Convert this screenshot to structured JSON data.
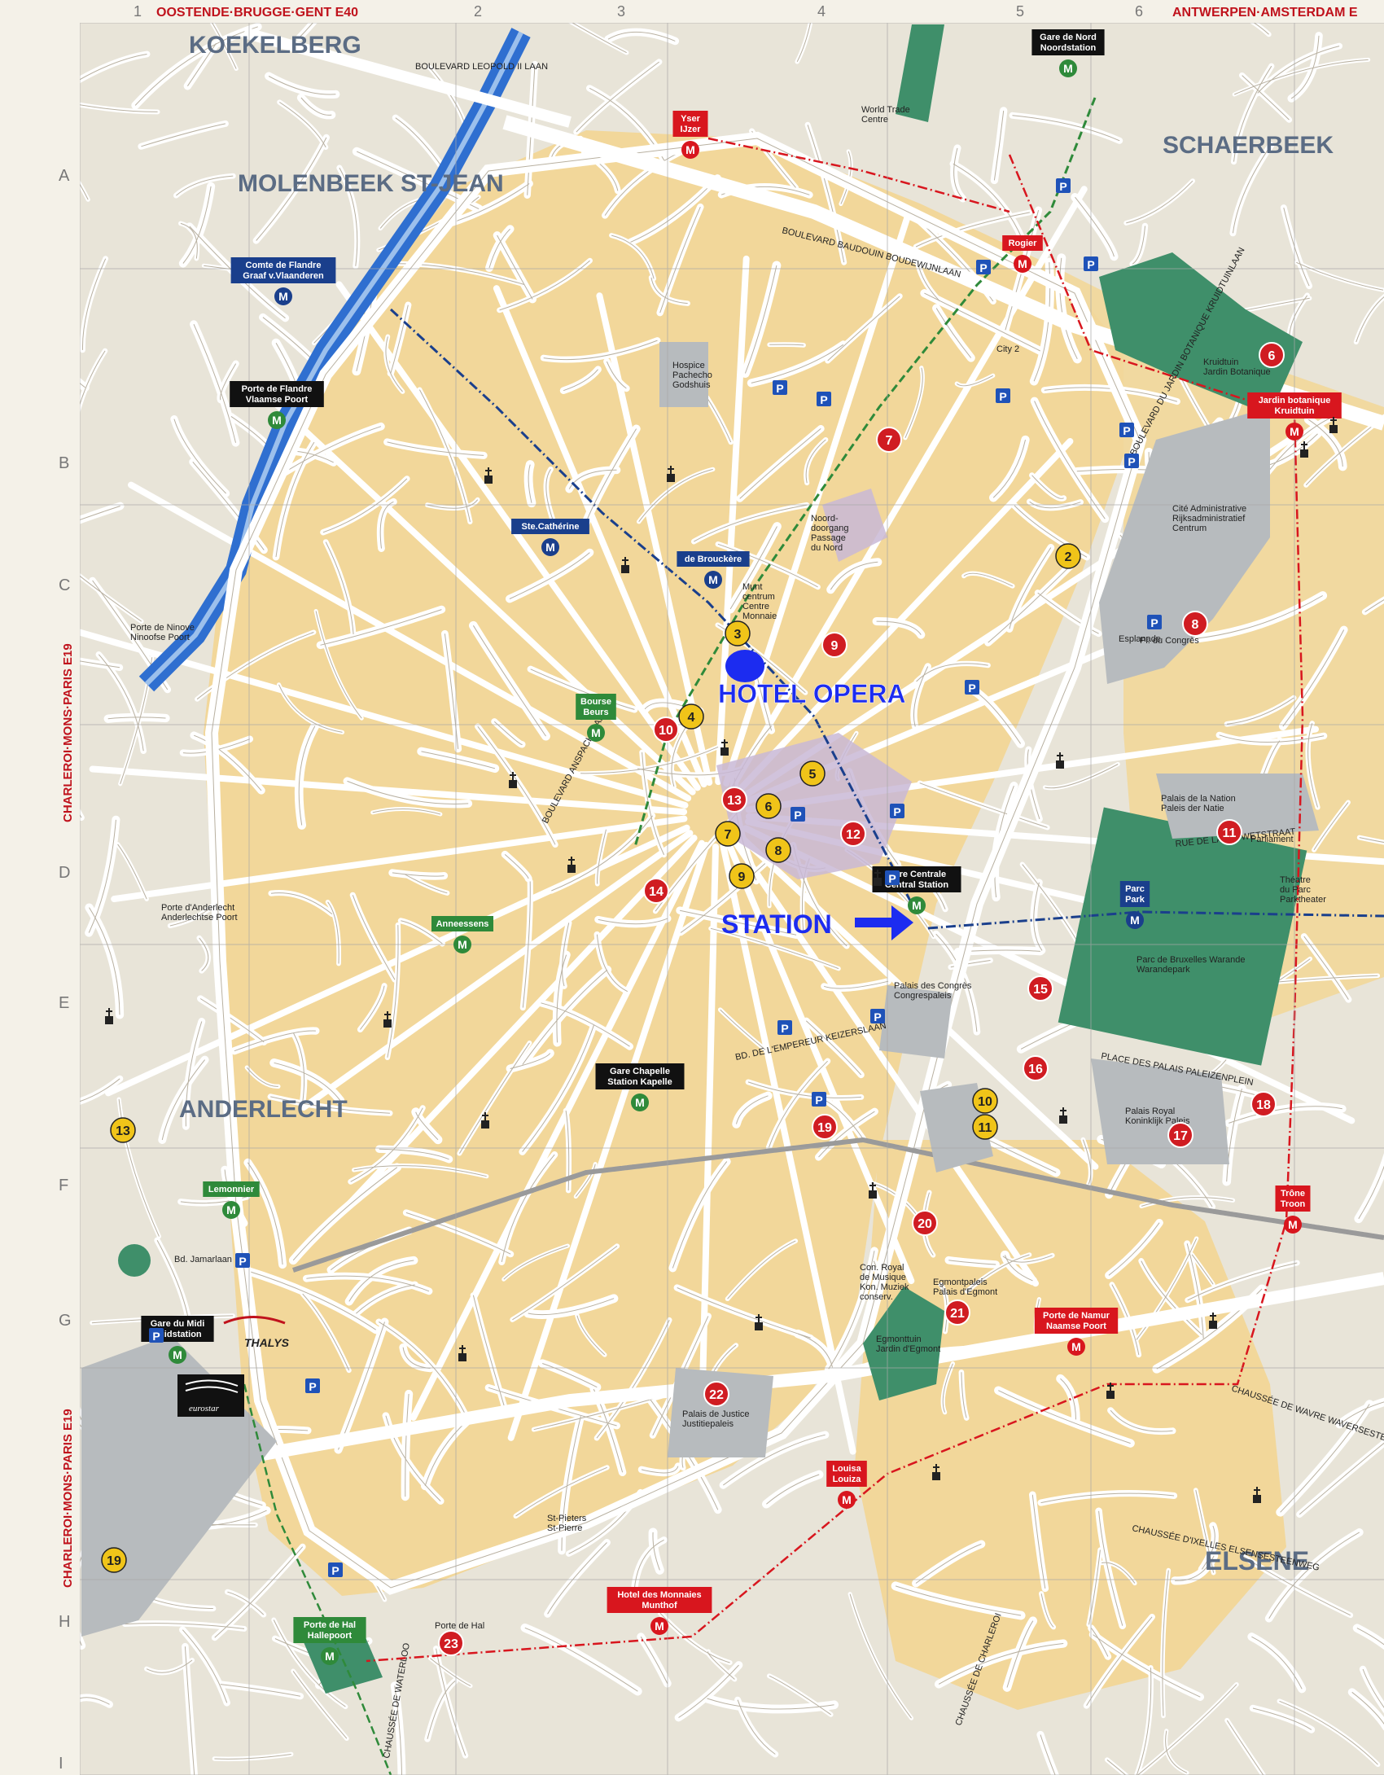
{
  "map": {
    "grid_columns": [
      "1",
      "2",
      "3",
      "4",
      "5",
      "6"
    ],
    "grid_rows": [
      "A",
      "B",
      "C",
      "D",
      "E",
      "F",
      "G",
      "H",
      "I"
    ],
    "edge_roads": {
      "top_left": "OOSTENDE·BRUGGE·GENT E40",
      "top_right": "ANTWERPEN·AMSTERDAM E",
      "left_upper": "CHARLEROI·MONS·PARIS E19",
      "left_lower": "CHARLEROI·MONS·PARIS E19"
    },
    "districts": {
      "koekelberg": "KOEKELBERG",
      "molenbeek": "MOLENBEEK ST-JEAN",
      "schaerbeek": "SCHAERBEEK",
      "anderlecht": "ANDERLECHT",
      "elsene": "ELSENE"
    },
    "annotations": {
      "hotel": "HOTEL OPERA",
      "station": "STATION"
    },
    "metro_stations": [
      {
        "label": "Gare de Nord\nNoordstation",
        "color": "#111111"
      },
      {
        "label": "Yser\nIJzer",
        "color": "#d8161e"
      },
      {
        "label": "Rogier",
        "color": "#d8161e"
      },
      {
        "label": "Comte de Flandre\nGraaf v.Vlaanderen",
        "color": "#1a3f8c"
      },
      {
        "label": "Porte de Flandre\nVlaamse Poort",
        "color": "#111111"
      },
      {
        "label": "Ste.Cathérine",
        "color": "#1a3f8c"
      },
      {
        "label": "de Brouckère",
        "color": "#1a3f8c"
      },
      {
        "label": "Bourse\nBeurs",
        "color": "#2f8a3a"
      },
      {
        "label": "Gare Centrale\nCentral Station",
        "color": "#111111"
      },
      {
        "label": "Parc\nPark",
        "color": "#1a3f8c"
      },
      {
        "label": "Anneessens",
        "color": "#2f8a3a"
      },
      {
        "label": "Gare Chapelle\nStation Kapelle",
        "color": "#111111"
      },
      {
        "label": "Lemonnier",
        "color": "#2f8a3a"
      },
      {
        "label": "Gare du Midi\nZuidstation",
        "color": "#111111"
      },
      {
        "label": "Jardin botanique\nKruidtuin",
        "color": "#d8161e"
      },
      {
        "label": "Trône\nTroon",
        "color": "#d8161e"
      },
      {
        "label": "Porte de Namur\nNaamse Poort",
        "color": "#d8161e"
      },
      {
        "label": "Louisa\nLouiza",
        "color": "#d8161e"
      },
      {
        "label": "Hotel des Monnaies\nMunthof",
        "color": "#d8161e"
      },
      {
        "label": "Porte de Hal\nHallepoort",
        "color": "#2f8a3a"
      }
    ],
    "place_labels": {
      "koekelberg_rd": "BOULEVARD LEOPOLD II LAAN",
      "hospice": "Hospice\nPachecho\nGodshuis",
      "wtc": "World Trade\nCentre",
      "city2": "City 2",
      "cite_admin": "Cité Administrative\nRijksadministratief\nCentrum",
      "esplanade": "Esplanade",
      "noord_doorgang": "Noord-\ndoorgang\nPassage\ndu Nord",
      "munt": "Munt\ncentrum\nCentre\nMonnaie",
      "palais_nation": "Palais de la Nation\nPaleis der Natie",
      "parliament": "Parliament",
      "theatre": "Théatre\ndu Parc\nParktheater",
      "parc_bruxelles": "Parc de Bruxelles Warande\nWarandepark",
      "palais_congres": "Palais des Congrès\nCongrespaleis",
      "palais_royal": "Palais Royal\nKoninklijk Paleis",
      "egmont_palais": "Egmontpaleis\nPalais d'Egmont",
      "egmont_jardin": "Egmonttuin\nJardin d'Egmont",
      "conservatoire": "Con. Royal\nde Musique\nKon. Muziek\nconserv.",
      "palais_justice": "Palais de Justice\nJustitiepaleis",
      "st_pieters": "St-Pieters\nSt-Pierre",
      "porte_anderlecht": "Porte d'Anderlecht\nAnderlechtse Poort",
      "porte_ninove": "Porte de Ninove\nNinoofse Poort",
      "kruidtuin": "Kruidtuin\nJardin Botanique",
      "porte_hal": "Porte de Hal",
      "thalys": "THALYS",
      "eurostar": "eurostar",
      "bvd_midi": "Bd. Jamarlaan",
      "place_congres": "Pl. du Congrès",
      "warandepark_rd": "PLACE DES PALAIS PALEIZENPLEIN",
      "rue_loi": "RUE DE LA LOI WETSTRAAT",
      "bvd_anspach": "BOULEVARD ANSPACHLAAN",
      "bvd_jardin": "BOULEVARD DU JARDIN BOTANIQUE KRUIDTUINLAAN",
      "bvd_baudouin": "BOULEVARD BAUDOUIN BOUDEWIJNLAAN",
      "bvd_emp": "BD. DE L'EMPEREUR KEIZERSLAAN",
      "ch_waterloo": "CHAUSSÉE DE WATERLOO",
      "waversesteenweg": "CHAUSSÉE DE WAVRE WAVERSESTEENWEG",
      "ch_ixelles": "CHAUSSÉE D'IXELLES ELSENSESTEENWEG",
      "ch_charleroi": "CHAUSSÉE DE CHARLEROI"
    },
    "pois_red": [
      {
        "n": "6"
      },
      {
        "n": "7"
      },
      {
        "n": "8"
      },
      {
        "n": "9"
      },
      {
        "n": "10"
      },
      {
        "n": "11"
      },
      {
        "n": "12"
      },
      {
        "n": "13"
      },
      {
        "n": "14"
      },
      {
        "n": "15"
      },
      {
        "n": "16"
      },
      {
        "n": "17"
      },
      {
        "n": "18"
      },
      {
        "n": "19"
      },
      {
        "n": "20"
      },
      {
        "n": "21"
      },
      {
        "n": "22"
      },
      {
        "n": "23"
      }
    ],
    "pois_yellow": [
      {
        "n": "2"
      },
      {
        "n": "3"
      },
      {
        "n": "4"
      },
      {
        "n": "5"
      },
      {
        "n": "6"
      },
      {
        "n": "7"
      },
      {
        "n": "8"
      },
      {
        "n": "9"
      },
      {
        "n": "10"
      },
      {
        "n": "11"
      },
      {
        "n": "13"
      },
      {
        "n": "19"
      }
    ],
    "parking_label": "P",
    "metro_letter": "M",
    "colors": {
      "block": "#f2d79a",
      "block_outer": "#e7e3d6",
      "street": "#ffffff",
      "street_edge": "#b9b1a0",
      "park": "#3f8f6a",
      "canal": "#2f6fd0",
      "pedestrian": "#c9b8d6",
      "grey_building": "#b7bbbe",
      "annotation_blue": "#1c2cf0",
      "red_poi": "#d01c22",
      "yellow_poi": "#f0c419"
    }
  }
}
